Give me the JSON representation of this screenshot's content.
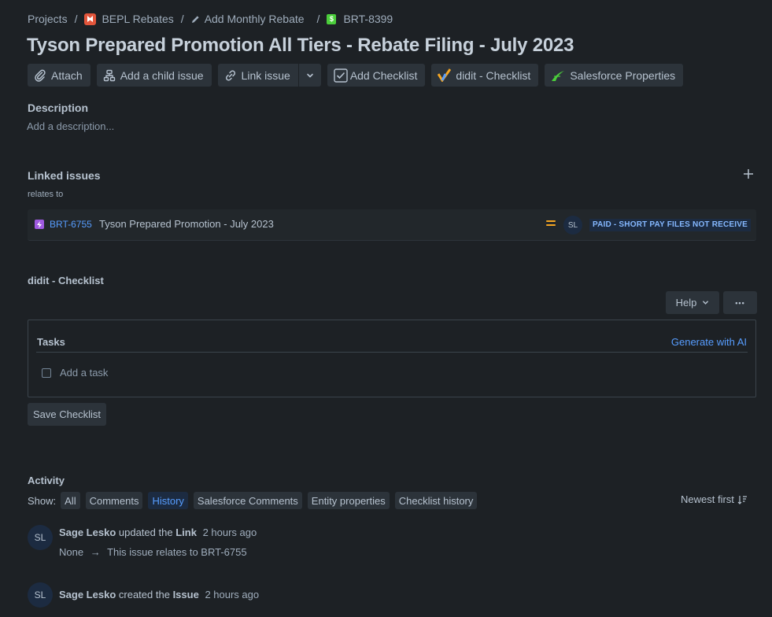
{
  "breadcrumb": {
    "projects": "Projects",
    "project": "BEPL Rebates",
    "parent": "Add Monthly Rebate",
    "issue_key": "BRT-8399",
    "separator": "/"
  },
  "title": "Tyson Prepared Promotion All Tiers - Rebate Filing - July 2023",
  "toolbar": {
    "attach": "Attach",
    "add_child": "Add a child issue",
    "link_issue": "Link issue",
    "add_checklist": "Add Checklist",
    "didit_checklist": "didit - Checklist",
    "salesforce": "Salesforce Properties"
  },
  "description": {
    "heading": "Description",
    "placeholder": "Add a description..."
  },
  "linked_issues": {
    "heading": "Linked issues",
    "relation": "relates to",
    "items": [
      {
        "key": "BRT-6755",
        "summary": "Tyson Prepared Promotion - July 2023",
        "priority": "medium",
        "assignee_initials": "SL",
        "status": "PAID - SHORT PAY FILES NOT RECEIVE"
      }
    ]
  },
  "checklist": {
    "heading": "didit - Checklist",
    "help": "Help",
    "more": "•••",
    "tasks_heading": "Tasks",
    "generate_ai": "Generate with AI",
    "add_task": "Add a task",
    "save": "Save Checklist"
  },
  "activity": {
    "heading": "Activity",
    "show_label": "Show:",
    "filters": [
      "All",
      "Comments",
      "History",
      "Salesforce Comments",
      "Entity properties",
      "Checklist history"
    ],
    "active_filter": "History",
    "sort": "Newest first",
    "entries": [
      {
        "initials": "SL",
        "user": "Sage Lesko",
        "verb": "updated the",
        "object": "Link",
        "time": "2 hours ago",
        "from": "None",
        "arrow": "→",
        "to": "This issue relates to BRT-6755"
      },
      {
        "initials": "SL",
        "user": "Sage Lesko",
        "verb": "created the",
        "object": "Issue",
        "time": "2 hours ago"
      }
    ]
  },
  "colors": {
    "background": "#1d2125",
    "link": "#579dff",
    "priority_medium": "#f5a623",
    "status_bg": "#1c2b41"
  }
}
